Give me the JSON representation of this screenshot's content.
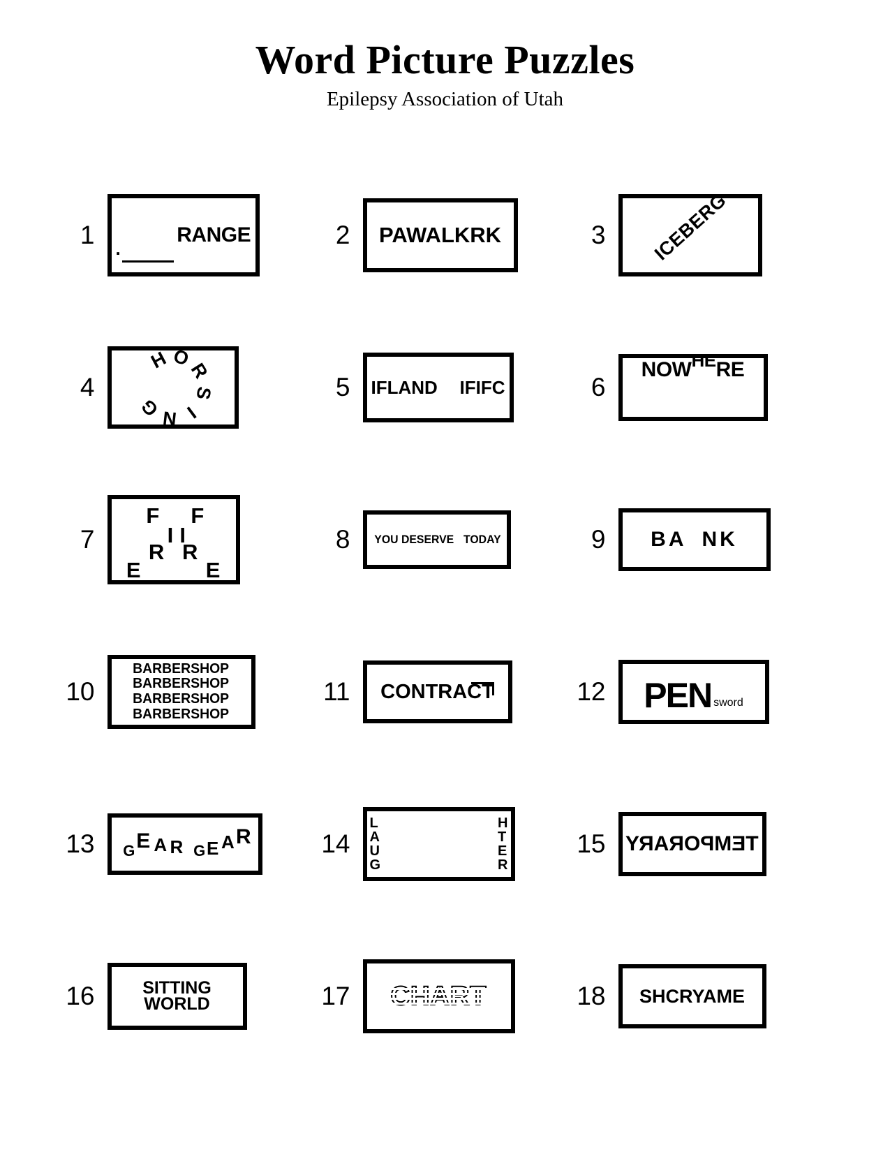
{
  "header": {
    "title": "Word Picture Puzzles",
    "subtitle": "Epilepsy Association of Utah"
  },
  "puzzles": [
    {
      "number": "1",
      "style": "blank-then-word",
      "dot": ".",
      "text": "RANGE"
    },
    {
      "number": "2",
      "style": "plain",
      "text": "PAWALKRK"
    },
    {
      "number": "3",
      "style": "rotated-diagonal",
      "text": "ICEBERG",
      "rotation_degrees": "-42"
    },
    {
      "number": "4",
      "style": "circular",
      "text": "HORSING",
      "letters": [
        "H",
        "O",
        "R",
        "S",
        "I",
        "N",
        "G"
      ]
    },
    {
      "number": "5",
      "style": "two-words-spaced",
      "left": "IFLAND",
      "right": "IFIFC"
    },
    {
      "number": "6",
      "style": "raised-middle",
      "left": "NOW",
      "raised": "HE",
      "right": "RE"
    },
    {
      "number": "7",
      "style": "scattered-letters",
      "text": "FIRE FIRE",
      "letters": [
        "F",
        "F",
        "I",
        "I",
        "R",
        "R",
        "E",
        "E"
      ]
    },
    {
      "number": "8",
      "style": "two-words-spaced",
      "left": "YOU DESERVE",
      "right": "TODAY"
    },
    {
      "number": "9",
      "style": "split-word",
      "left": "BA",
      "right": "NK"
    },
    {
      "number": "10",
      "style": "repeated-lines",
      "text": "BARBERSHOP",
      "lines": [
        "BARBERSHOP",
        "BARBERSHOP",
        "BARBERSHOP",
        "BARBERSHOP"
      ]
    },
    {
      "number": "11",
      "style": "word-with-overline",
      "text": "CONTRACT"
    },
    {
      "number": "12",
      "style": "big-and-small",
      "big": "PEN",
      "small": "sword"
    },
    {
      "number": "13",
      "style": "wavy-letters",
      "text": "GEAR GEAR",
      "letters": [
        "G",
        "E",
        "A",
        "R",
        "G",
        "E",
        "A",
        "R"
      ]
    },
    {
      "number": "14",
      "style": "vertical-split",
      "left": "LAUG",
      "right": "HTER",
      "left_letters": [
        "L",
        "A",
        "U",
        "G"
      ],
      "right_letters": [
        "H",
        "T",
        "E",
        "R"
      ]
    },
    {
      "number": "15",
      "style": "mirrored",
      "text": "TEMPORARY"
    },
    {
      "number": "16",
      "style": "stacked-words",
      "lines": [
        "SITTING",
        "WORLD"
      ]
    },
    {
      "number": "17",
      "style": "dotted-outline",
      "text": "CHART"
    },
    {
      "number": "18",
      "style": "plain",
      "text": "SHCRYAME"
    }
  ]
}
